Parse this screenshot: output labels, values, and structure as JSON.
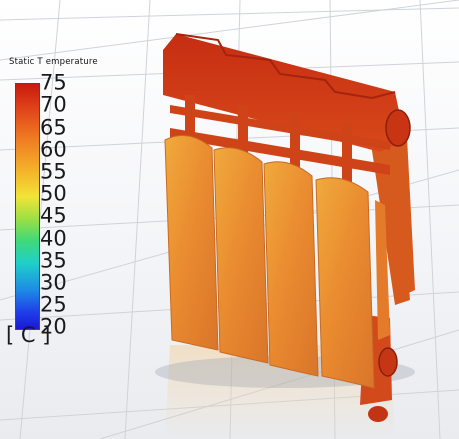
{
  "legend": {
    "title": "Static T emperature",
    "unit": "[ C ]",
    "ticks": [
      "75",
      "70",
      "65",
      "60",
      "55",
      "50",
      "45",
      "40",
      "35",
      "30",
      "25",
      "20"
    ]
  }
}
